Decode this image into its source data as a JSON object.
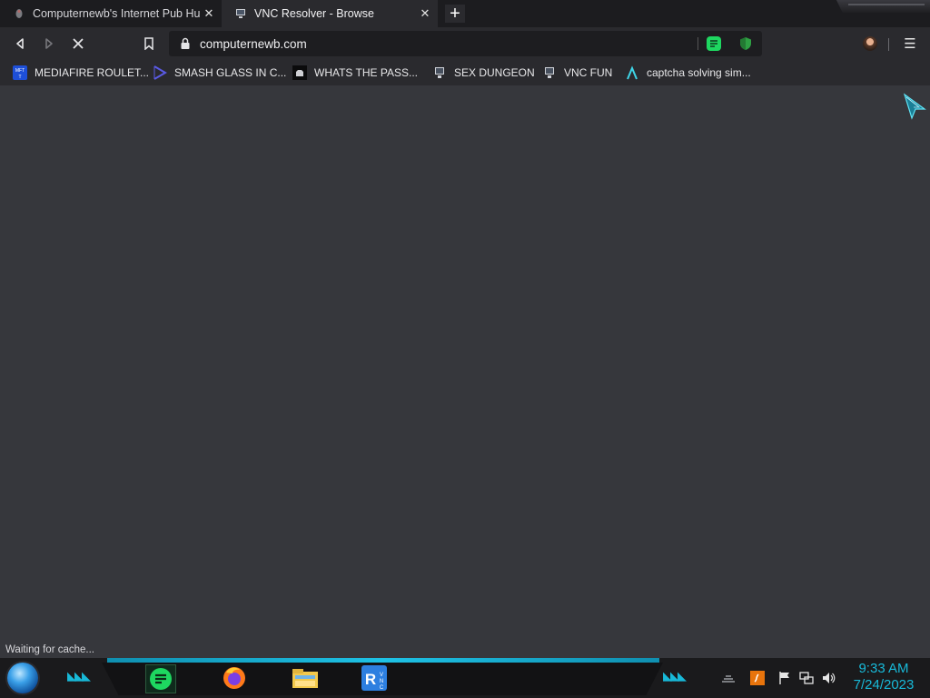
{
  "browser": {
    "tabs": [
      {
        "title": "Computernewb's Internet Pub Hub",
        "active": false
      },
      {
        "title": "VNC Resolver - Browse",
        "active": true
      }
    ],
    "close_glyph": "✕",
    "new_tab_glyph": "+",
    "address": "computernewb.com",
    "status_text": "Waiting for cache...",
    "menu_glyph": "☰"
  },
  "bookmarks": [
    {
      "label": "MEDIAFIRE ROULET...",
      "icon": "mediafire-icon"
    },
    {
      "label": "SMASH GLASS IN C...",
      "icon": "chevron-logo-icon"
    },
    {
      "label": "WHATS THE PASS...",
      "icon": "cat-icon"
    },
    {
      "label": "SEX DUNGEON",
      "icon": "vnc-icon"
    },
    {
      "label": "VNC FUN",
      "icon": "vnc-icon"
    },
    {
      "label": "captcha solving sim...",
      "icon": "lambda-icon"
    }
  ],
  "taskbar": {
    "time": "9:33 AM",
    "date": "7/24/2023",
    "pinned": [
      "spotify-icon",
      "firefox-icon",
      "file-explorer-icon",
      "vnc-resolver-icon"
    ]
  },
  "colors": {
    "accent": "#18b9d8",
    "page_bg": "#36373c",
    "toolbar_bg": "#2a2a2e",
    "spotify_green": "#1ed760"
  }
}
